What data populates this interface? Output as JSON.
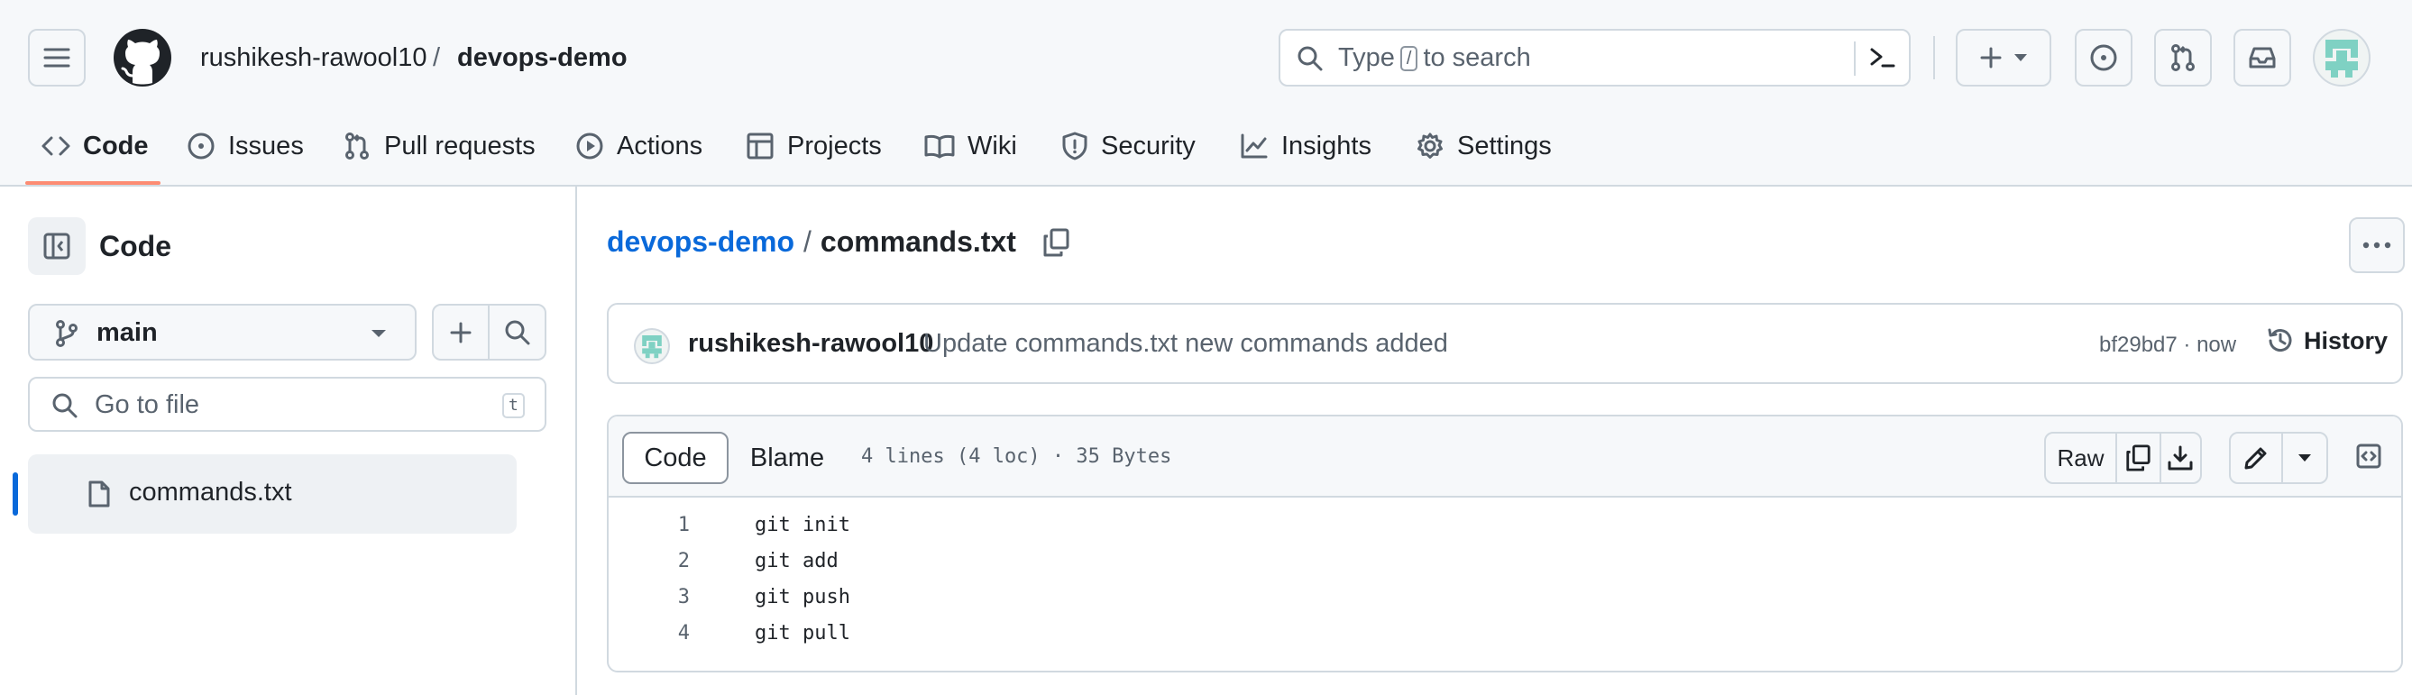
{
  "header": {
    "owner": "rushikesh-rawool10",
    "separator": "/",
    "repo": "devops-demo",
    "search_prefix": "Type",
    "search_key": "/",
    "search_suffix": "to search"
  },
  "tabs": [
    {
      "label": "Code",
      "icon": "code-icon"
    },
    {
      "label": "Issues",
      "icon": "issue-icon"
    },
    {
      "label": "Pull requests",
      "icon": "pull-request-icon"
    },
    {
      "label": "Actions",
      "icon": "play-icon"
    },
    {
      "label": "Projects",
      "icon": "table-icon"
    },
    {
      "label": "Wiki",
      "icon": "book-icon"
    },
    {
      "label": "Security",
      "icon": "shield-icon"
    },
    {
      "label": "Insights",
      "icon": "graph-icon"
    },
    {
      "label": "Settings",
      "icon": "gear-icon"
    }
  ],
  "sidebar": {
    "title": "Code",
    "branch": "main",
    "goto_placeholder": "Go to file",
    "goto_key": "t",
    "files": [
      {
        "name": "commands.txt",
        "icon": "file-icon"
      }
    ]
  },
  "main": {
    "repo": "devops-demo",
    "separator": "/",
    "filename": "commands.txt",
    "commit": {
      "author": "rushikesh-rawool10",
      "message": "Update commands.txt new commands added",
      "sha_time": "bf29bd7 · now",
      "history_label": "History"
    },
    "file": {
      "tab_code": "Code",
      "tab_blame": "Blame",
      "meta": "4 lines (4 loc) · 35 Bytes",
      "raw_label": "Raw",
      "lines": [
        {
          "n": "1",
          "text": "git init"
        },
        {
          "n": "2",
          "text": "git add"
        },
        {
          "n": "3",
          "text": "git push"
        },
        {
          "n": "4",
          "text": "git pull"
        }
      ]
    }
  },
  "colors": {
    "accent": "#0969da",
    "tab_underline": "#fd8c73",
    "avatar": "#7fd1c3",
    "border": "#d1d9e0"
  }
}
